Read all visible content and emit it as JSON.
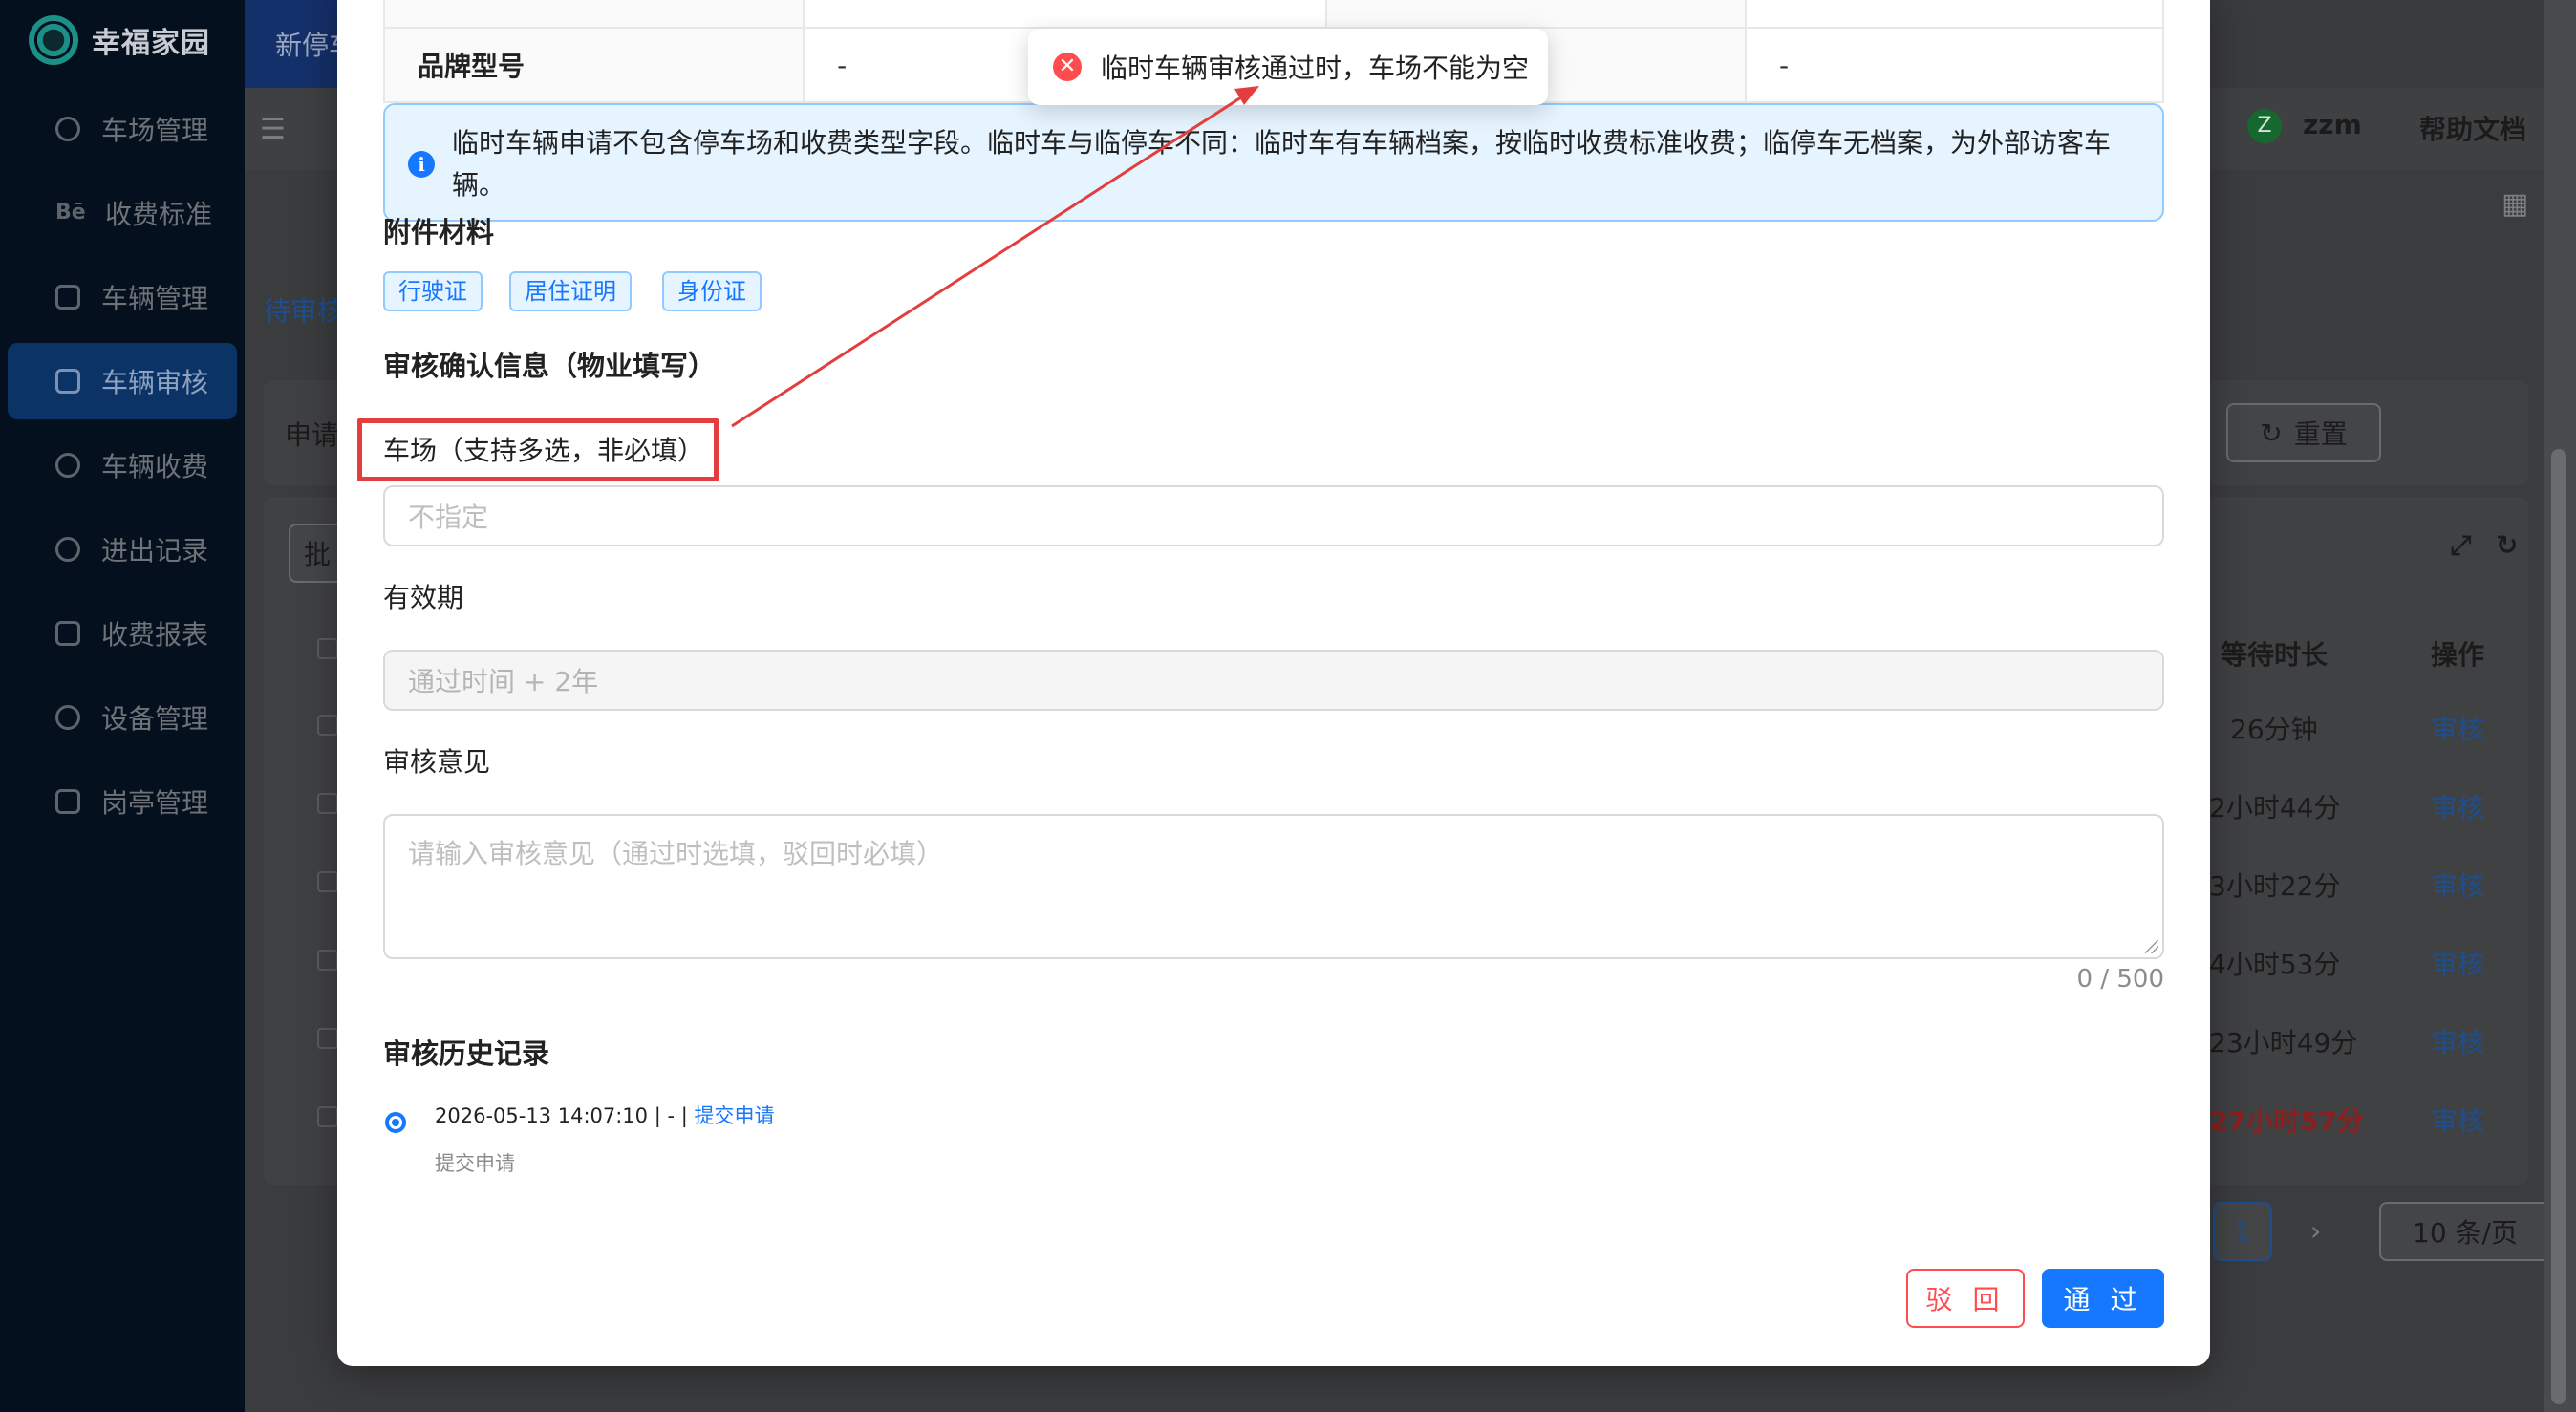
{
  "app": {
    "name": "幸福家园",
    "top_tab": "新停车"
  },
  "sidebar": {
    "items": [
      {
        "label": "车场管理"
      },
      {
        "label": "收费标准"
      },
      {
        "label": "车辆管理"
      },
      {
        "label": "车辆审核"
      },
      {
        "label": "车辆收费"
      },
      {
        "label": "进出记录"
      },
      {
        "label": "收费报表"
      },
      {
        "label": "设备管理"
      },
      {
        "label": "岗亭管理"
      }
    ]
  },
  "background": {
    "user": "zzm",
    "user_initial": "Z",
    "help": "帮助文档",
    "tab_pending": "待审核",
    "filter_label": "申请",
    "reset_button": "重置",
    "batch_button": "批",
    "table_headers": {
      "wait": "等待时长",
      "action": "操作"
    },
    "rows": [
      {
        "wait": "26分钟",
        "action": "审核",
        "red": false
      },
      {
        "wait": "2小时44分",
        "action": "审核",
        "red": false
      },
      {
        "wait": "3小时22分",
        "action": "审核",
        "red": false
      },
      {
        "wait": "4小时53分",
        "action": "审核",
        "red": false
      },
      {
        "wait": "23小时49分",
        "action": "审核",
        "red": false
      },
      {
        "wait": "27小时57分",
        "action": "审核",
        "red": true
      }
    ],
    "pagination": {
      "current": "1",
      "page_size": "10 条/页"
    }
  },
  "modal": {
    "table": {
      "label1": "品牌型号",
      "value1": "-",
      "value2": "-"
    },
    "alert_text": "临时车辆申请不包含停车场和收费类型字段。临时车与临停车不同：临时车有车辆档案，按临时收费标准收费；临停车无档案，为外部访客车辆。",
    "attachments": {
      "title": "附件材料",
      "tags": [
        "行驶证",
        "居住证明",
        "身份证"
      ]
    },
    "review": {
      "title": "审核确认信息（物业填写）",
      "parking_label": "车场（支持多选，非必填）",
      "parking_placeholder": "不指定",
      "validity_label": "有效期",
      "validity_value": "通过时间 + 2年",
      "opinion_label": "审核意见",
      "opinion_placeholder": "请输入审核意见（通过时选填，驳回时必填）",
      "counter": "0 / 500"
    },
    "history": {
      "title": "审核历史记录",
      "entry_time": "2026-05-13 14:07:10 | - |",
      "entry_link": "提交申请",
      "entry_sub": "提交申请"
    },
    "buttons": {
      "reject": "驳 回",
      "approve": "通 过"
    }
  },
  "toast": {
    "message": "临时车辆审核通过时，车场不能为空"
  },
  "colors": {
    "primary": "#1677ff",
    "danger": "#ff4d4f",
    "annotation": "#e33d3d"
  }
}
